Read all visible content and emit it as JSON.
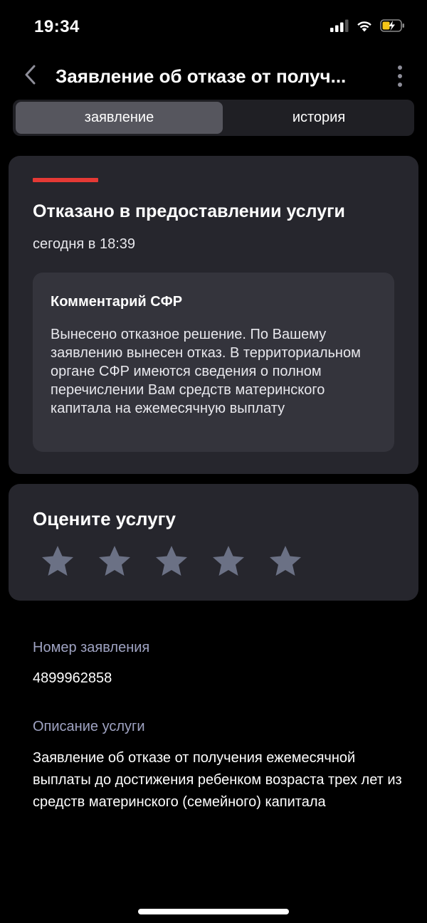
{
  "status_bar": {
    "time": "19:34"
  },
  "header": {
    "title": "Заявление об отказе от получ..."
  },
  "tabs": [
    {
      "label": "заявление",
      "active": true
    },
    {
      "label": "история",
      "active": false
    }
  ],
  "status_card": {
    "accent_color": "#e53935",
    "title": "Отказано в предоставлении услуги",
    "date": "сегодня в 18:39",
    "comment_title": "Комментарий СФР",
    "comment_text": "Вынесено отказное решение. По Вашему заявлению вынесен отказ. В территориальном органе СФР имеются сведения о полном перечислении Вам средств материнского капитала на ежемесячную выплату"
  },
  "rating": {
    "title": "Оцените услугу",
    "max": 5,
    "value": 0
  },
  "details": {
    "number_label": "Номер заявления",
    "number_value": "4899962858",
    "description_label": "Описание услуги",
    "description_value": "Заявление об отказе от получения ежемесячной выплаты до достижения ребенком возраста трех лет из средств материнского (семейного) капитала"
  },
  "icons": {
    "back": "chevron-left-icon",
    "more": "more-vertical-icon",
    "star": "star-icon"
  }
}
